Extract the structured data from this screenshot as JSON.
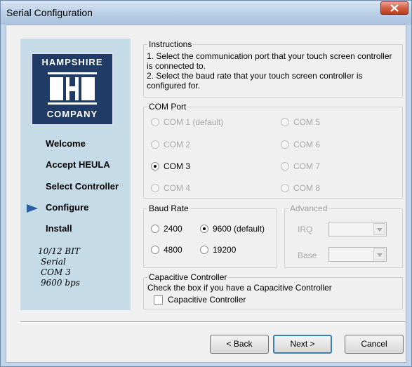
{
  "window": {
    "title": "Serial Configuration"
  },
  "sidebar": {
    "logo": {
      "top_text": "HAMPSHIRE",
      "bottom_text": "COMPANY"
    },
    "nav": [
      {
        "label": "Welcome",
        "current": false
      },
      {
        "label": "Accept HEULA",
        "current": false
      },
      {
        "label": "Select Controller",
        "current": false
      },
      {
        "label": "Configure",
        "current": true
      },
      {
        "label": "Install",
        "current": false
      }
    ],
    "summary": [
      "10/12 BIT",
      "Serial",
      "COM 3",
      "9600 bps"
    ]
  },
  "instructions": {
    "label": "Instructions",
    "line1": "1. Select the communication port that your touch screen controller is connected to.",
    "line2": "2. Select the baud rate that your touch screen controller is configured for."
  },
  "com_port": {
    "label": "COM Port",
    "options": [
      {
        "label": "COM 1 (default)",
        "selected": false,
        "enabled": false
      },
      {
        "label": "COM 5",
        "selected": false,
        "enabled": false
      },
      {
        "label": "COM 2",
        "selected": false,
        "enabled": false
      },
      {
        "label": "COM 6",
        "selected": false,
        "enabled": false
      },
      {
        "label": "COM 3",
        "selected": true,
        "enabled": true
      },
      {
        "label": "COM 7",
        "selected": false,
        "enabled": false
      },
      {
        "label": "COM 4",
        "selected": false,
        "enabled": false
      },
      {
        "label": "COM 8",
        "selected": false,
        "enabled": false
      }
    ]
  },
  "baud_rate": {
    "label": "Baud Rate",
    "options": [
      {
        "label": "2400",
        "selected": false
      },
      {
        "label": "9600 (default)",
        "selected": true
      },
      {
        "label": "4800",
        "selected": false
      },
      {
        "label": "19200",
        "selected": false
      }
    ]
  },
  "advanced": {
    "label": "Advanced",
    "irq_label": "IRQ",
    "irq_value": "",
    "base_label": "Base",
    "base_value": "",
    "enabled": false
  },
  "capacitive": {
    "label": "Capacitive Controller",
    "description": "Check the box if you have a Capacitive Controller",
    "checkbox_label": "Capacitive Controller",
    "checked": false
  },
  "buttons": {
    "back": "< Back",
    "next": "Next >",
    "cancel": "Cancel"
  },
  "colors": {
    "sidebar_bg": "#c5dbe8",
    "logo_bg": "#1f3b66",
    "title_bar": "#bcd1e7",
    "close_button": "#c0391c",
    "default_button_border": "#3c7fb1"
  }
}
